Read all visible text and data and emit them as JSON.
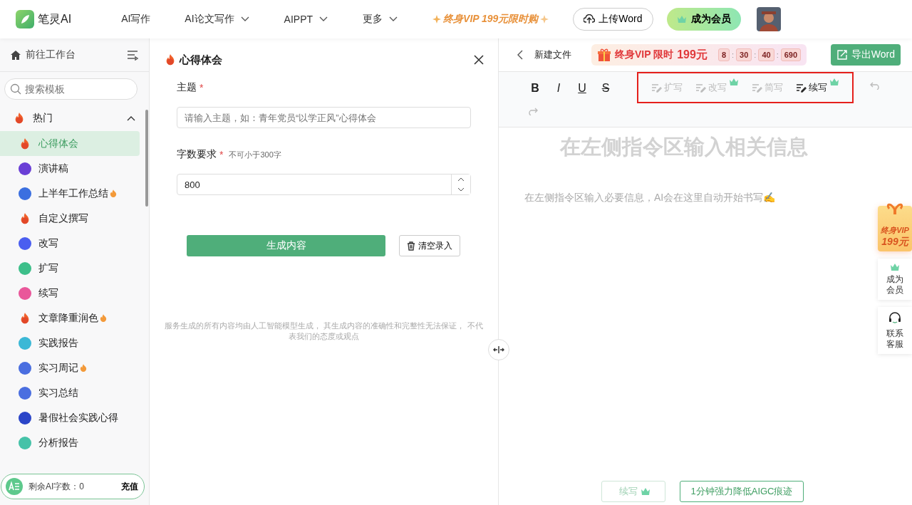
{
  "header": {
    "brand": "笔灵AI",
    "nav": [
      {
        "label": "AI写作",
        "dropdown": false
      },
      {
        "label": "AI论文写作",
        "dropdown": true
      },
      {
        "label": "AIPPT",
        "dropdown": true
      },
      {
        "label": "更多",
        "dropdown": true
      }
    ],
    "promo": "终身VIP 199元限时购",
    "upload": "上传Word",
    "member": "成为会员"
  },
  "sidebar": {
    "workbench": "前往工作台",
    "search_placeholder": "搜索模板",
    "group": {
      "label": "热门",
      "expanded": true
    },
    "items": [
      {
        "label": "心得体会",
        "kind": "flame",
        "hot": false,
        "selected": true
      },
      {
        "label": "演讲稿",
        "kind": "round",
        "color": "#6a3fd6",
        "hot": false,
        "selected": false
      },
      {
        "label": "上半年工作总结",
        "kind": "round",
        "color": "#3b6fe0",
        "hot": true,
        "selected": false
      },
      {
        "label": "自定义撰写",
        "kind": "flame",
        "hot": false,
        "selected": false
      },
      {
        "label": "改写",
        "kind": "round",
        "color": "#4a5ef0",
        "hot": false,
        "selected": false
      },
      {
        "label": "扩写",
        "kind": "round",
        "color": "#3dbf8a",
        "hot": false,
        "selected": false
      },
      {
        "label": "续写",
        "kind": "round",
        "color": "#e9579a",
        "hot": false,
        "selected": false
      },
      {
        "label": "文章降重润色",
        "kind": "flame",
        "hot": true,
        "selected": false
      },
      {
        "label": "实践报告",
        "kind": "round",
        "color": "#3bb8d6",
        "hot": false,
        "selected": false
      },
      {
        "label": "实习周记",
        "kind": "round",
        "color": "#4a6ee0",
        "hot": true,
        "selected": false
      },
      {
        "label": "实习总结",
        "kind": "round",
        "color": "#4a6ee0",
        "hot": false,
        "selected": false
      },
      {
        "label": "暑假社会实践心得",
        "kind": "round",
        "color": "#2b45c8",
        "hot": false,
        "selected": false
      },
      {
        "label": "分析报告",
        "kind": "round",
        "color": "#45c2a8",
        "hot": false,
        "selected": false
      }
    ],
    "quota": {
      "label": "剩余AI字数：0",
      "action": "充值"
    }
  },
  "form": {
    "title": "心得体会",
    "required_mark": "*",
    "fields": [
      {
        "label": "主题",
        "required": true,
        "kind": "text",
        "placeholder": "请输入主题，如：青年党员“以学正风”心得体会"
      },
      {
        "label": "字数要求",
        "required": true,
        "hint": "不可小于300字",
        "kind": "number",
        "value": "800"
      }
    ],
    "generate": "生成内容",
    "clear": "清空录入",
    "disclaimer": "服务生成的所有内容均由人工智能模型生成， 其生成内容的准确性和完整性无法保证， 不代表我们的态度或观点"
  },
  "editor": {
    "file": "新建文件",
    "vip_banner": {
      "text": "终身VIP 限时",
      "price": "199元",
      "countdown": [
        "8",
        "30",
        "40",
        "690"
      ],
      "separator": ":"
    },
    "export": "导出Word",
    "format": [
      "B",
      "I",
      "U",
      "S"
    ],
    "tools": [
      {
        "label": "扩写",
        "disabled": true,
        "vip": false
      },
      {
        "label": "改写",
        "disabled": true,
        "vip": true
      },
      {
        "label": "简写",
        "disabled": true,
        "vip": false
      },
      {
        "label": "续写",
        "disabled": false,
        "vip": true
      }
    ],
    "heading": "在左侧指令区输入相关信息",
    "prompt": "在左侧指令区输入必要信息，AI会在这里自动开始书写✍️",
    "bottom": [
      {
        "label": "续写",
        "kind": "disabled",
        "vip": true
      },
      {
        "label": "1分钟强力降低AIGC痕迹",
        "kind": "outline",
        "vip": false
      }
    ]
  },
  "float": {
    "vip": {
      "line1": "终身VIP",
      "line2": "199元"
    },
    "member": "成为会员",
    "service": "联系客服"
  }
}
